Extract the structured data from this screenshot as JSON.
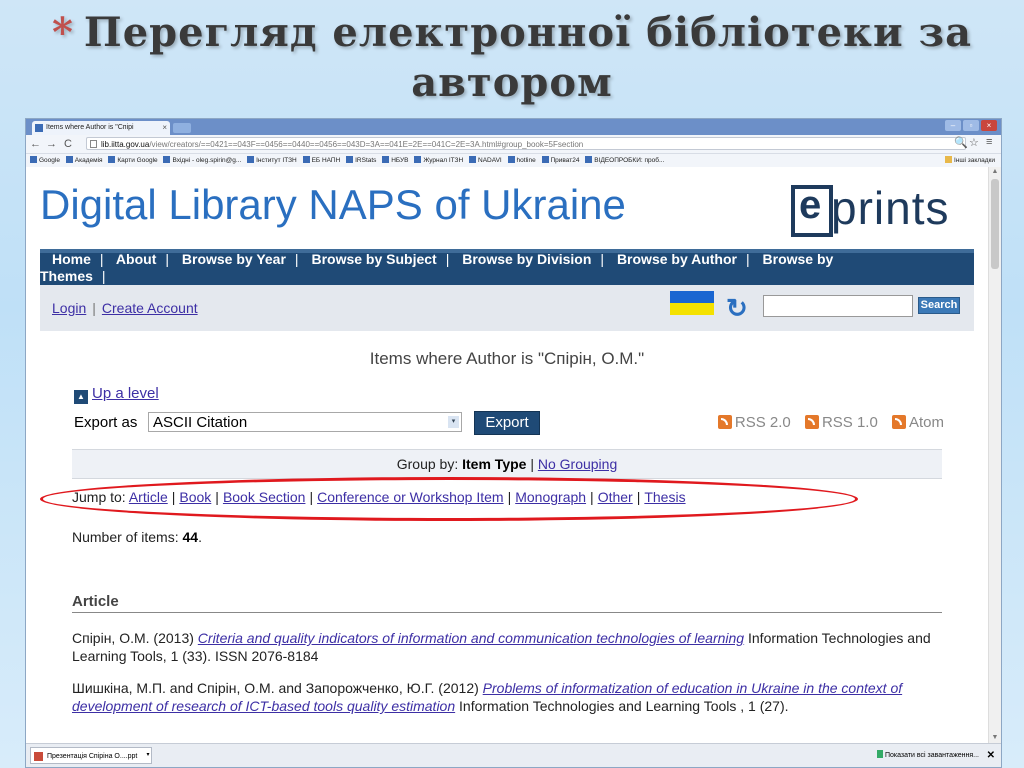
{
  "slide": {
    "bullet": "*",
    "title_line1": "Перегляд електронної бібліотеки за",
    "title_line2": "автором"
  },
  "browser": {
    "tab_title": "Items where Author is \"Спірі",
    "url_host": "lib.iitta.gov.ua",
    "url_path": "/view/creators/==0421==043F==0456==0440==0456==043D=3A==041E=2E==041C=2E=3A.html#group_book=5Fsection",
    "bookmarks": [
      "Google",
      "Академія",
      "Карти Google",
      "Вхідні - oleg.spirin@g...",
      "Інститут ІТЗН",
      "ЕБ НАПН",
      "IRStats",
      "НБУВ",
      "Журнал ІТЗН",
      "NADAVI",
      "hotline",
      "Приват24",
      "ВІДЕОПРОБКИ: проб..."
    ],
    "bookmarks_other": "Інші закладки"
  },
  "site": {
    "title": "Digital Library NAPS of Ukraine",
    "logo_text": "prints",
    "logo_e": "e",
    "menu_line1": [
      "Home",
      "About",
      "Browse by Year",
      "Browse by Subject",
      "Browse by Division",
      "Browse by Author",
      "Browse by"
    ],
    "menu_line2": "Themes",
    "login": "Login",
    "create_account": "Create Account",
    "search_button": "Search",
    "search_value": ""
  },
  "page": {
    "heading": "Items where Author is \"Спірін, О.М.\"",
    "up_level": "Up a level",
    "export_label": "Export as",
    "export_selected": "ASCII Citation",
    "export_button": "Export",
    "feeds": [
      "RSS 2.0",
      "RSS 1.0",
      "Atom"
    ],
    "group_by_label": "Group by:",
    "group_by_current": "Item Type",
    "group_by_alt": "No Grouping",
    "jump_label": "Jump to:",
    "jump_links": [
      "Article",
      "Book",
      "Book Section",
      "Conference or Workshop Item",
      "Monograph",
      "Other",
      "Thesis"
    ],
    "num_items_label": "Number of items:",
    "num_items_value": "44",
    "section": "Article",
    "entry1_authors": "Спірін, О.М. (2013) ",
    "entry1_title": "Criteria and quality indicators of information and communication technologies of learning",
    "entry1_rest": " Information Technologies and Learning Tools, 1 (33). ISSN 2076-8184",
    "entry2_authors": "Шишкіна, М.П. and Спірін, О.М. and Запорожченко, Ю.Г. (2012) ",
    "entry2_title": "Problems of informatization of education in Ukraine in the context of development of research of ICT-based tools quality estimation",
    "entry2_rest": " Information Technologies and Learning Tools , 1 (27)."
  },
  "taskbar": {
    "download_item": "Презентація Спіріна О....ppt",
    "show_all": "Показати всі завантаження..."
  },
  "colors": {
    "site_blue": "#2a6fc0",
    "menu_navy": "#1f4a76",
    "link_purple": "#3d2fa5",
    "highlight_red": "#e0191e",
    "title_star": "#c0504d"
  }
}
